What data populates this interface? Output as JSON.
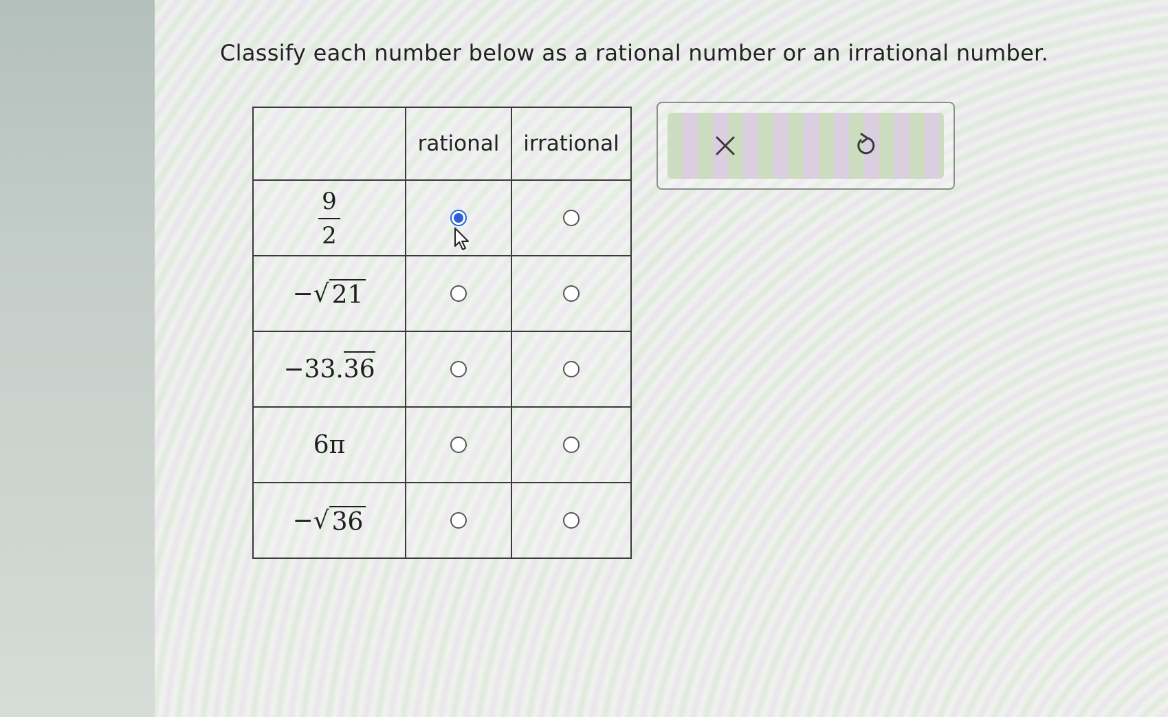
{
  "question": "Classify each number below as a rational number or an irrational number.",
  "table": {
    "headers": [
      "",
      "rational",
      "irrational"
    ],
    "rows": [
      {
        "type": "fraction",
        "numerator": "9",
        "denominator": "2",
        "selected": "rational"
      },
      {
        "type": "sqrt",
        "sign": "−",
        "radicand": "21",
        "selected": null
      },
      {
        "type": "repeating",
        "prefix": "−33.",
        "repeat": "36",
        "selected": null
      },
      {
        "type": "plain",
        "text": "6π",
        "selected": null
      },
      {
        "type": "sqrt",
        "sign": "−",
        "radicand": "36",
        "selected": null
      }
    ]
  },
  "actions": {
    "clear_icon": "x-icon",
    "undo_icon": "undo-icon"
  },
  "colors": {
    "selected_radio": "#2a62d6"
  }
}
